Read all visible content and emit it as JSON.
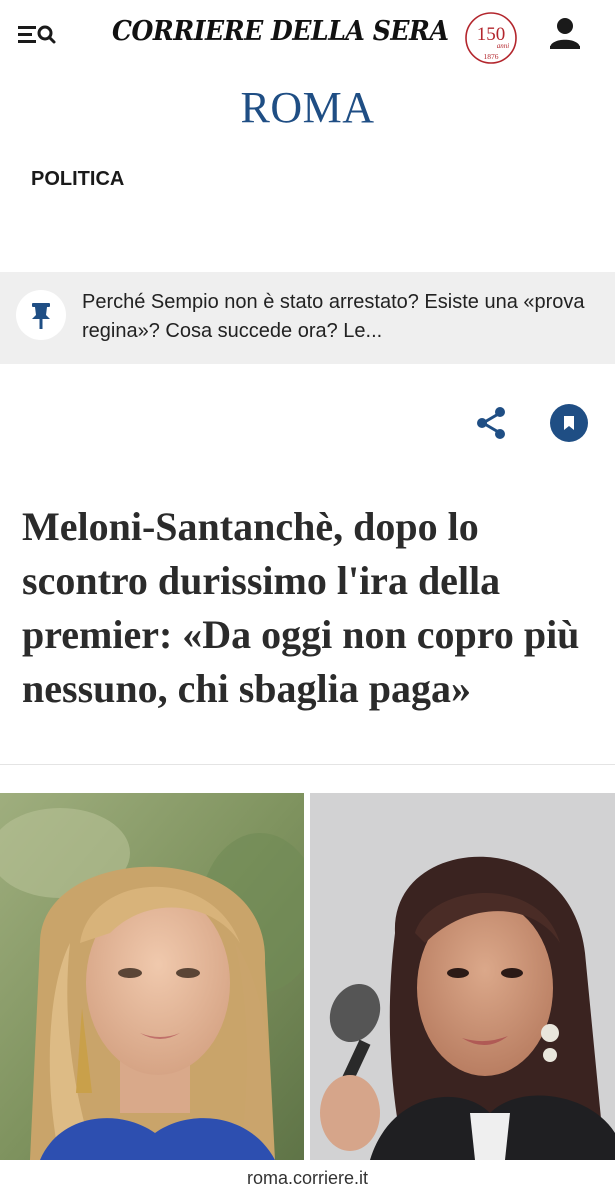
{
  "header": {
    "menu_icon": "menu-icon",
    "search_icon": "search-icon",
    "logo_text": "CORRIERE DELLA SERA",
    "anniversary_number": "150",
    "anniversary_word": "anni",
    "anniversary_year": "1876",
    "user_icon": "user-icon"
  },
  "section": {
    "title": "ROMA"
  },
  "category": {
    "label": "POLITICA"
  },
  "pinned": {
    "icon": "pin-icon",
    "text": "Perché Sempio non è stato arrestato? Esiste una «prova regina»? Cosa succede ora? Le..."
  },
  "actions": {
    "share_icon": "share-icon",
    "bookmark_icon": "bookmark-icon"
  },
  "article": {
    "headline": "Meloni-Santanchè, dopo lo scontro durissimo l'ira della premier: «Da oggi non copro più nessuno, chi sbaglia paga»"
  },
  "footer": {
    "source": "roma.corriere.it"
  },
  "colors": {
    "brand_blue": "#1f4e84",
    "anniversary_red": "#b3262d",
    "banner_gray": "#efefef"
  }
}
